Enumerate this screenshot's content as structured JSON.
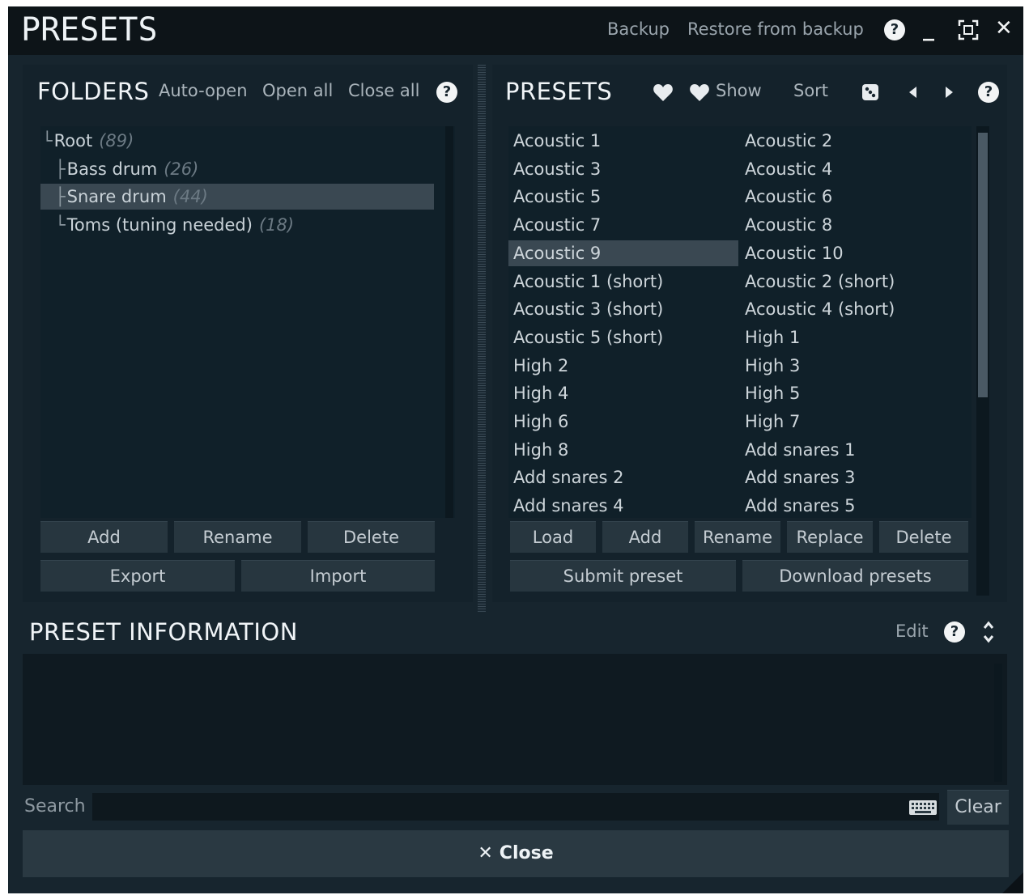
{
  "window": {
    "title": "PRESETS",
    "backup_label": "Backup",
    "restore_label": "Restore from backup",
    "help_glyph": "?",
    "minimize_glyph": "_",
    "close_glyph": "✕"
  },
  "folders": {
    "title": "FOLDERS",
    "auto_open": "Auto-open",
    "open_all": "Open all",
    "close_all": "Close all",
    "help_glyph": "?",
    "tree": [
      {
        "label": "Root",
        "count": "(89)",
        "connector": "└",
        "selected": false
      },
      {
        "label": "Bass drum",
        "count": "(26)",
        "connector": "├",
        "selected": false
      },
      {
        "label": "Snare drum",
        "count": "(44)",
        "connector": "├",
        "selected": true
      },
      {
        "label": "Toms (tuning needed)",
        "count": "(18)",
        "connector": "└",
        "selected": false
      }
    ],
    "buttons": {
      "add": "Add",
      "rename": "Rename",
      "delete": "Delete",
      "export": "Export",
      "import": "Import"
    }
  },
  "presets": {
    "title": "PRESETS",
    "show_label": "Show",
    "sort_label": "Sort",
    "help_glyph": "?",
    "selected": "Acoustic 9",
    "items": [
      "Acoustic 1",
      "Acoustic 2",
      "Acoustic 3",
      "Acoustic 4",
      "Acoustic 5",
      "Acoustic 6",
      "Acoustic 7",
      "Acoustic 8",
      "Acoustic 9",
      "Acoustic 10",
      "Acoustic 1 (short)",
      "Acoustic 2 (short)",
      "Acoustic 3 (short)",
      "Acoustic 4 (short)",
      "Acoustic 5 (short)",
      "High 1",
      "High 2",
      "High 3",
      "High 4",
      "High 5",
      "High 6",
      "High 7",
      "High 8",
      "Add snares 1",
      "Add snares 2",
      "Add snares 3",
      "Add snares 4",
      "Add snares 5"
    ],
    "scroll_fraction": 0.58,
    "buttons": {
      "load": "Load",
      "add": "Add",
      "rename": "Rename",
      "replace": "Replace",
      "delete": "Delete",
      "submit": "Submit preset",
      "download": "Download presets"
    }
  },
  "info": {
    "title": "PRESET INFORMATION",
    "edit_label": "Edit",
    "help_glyph": "?"
  },
  "search": {
    "label": "Search",
    "value": "",
    "clear_label": "Clear"
  },
  "close": {
    "glyph": "✕",
    "label": "Close"
  }
}
